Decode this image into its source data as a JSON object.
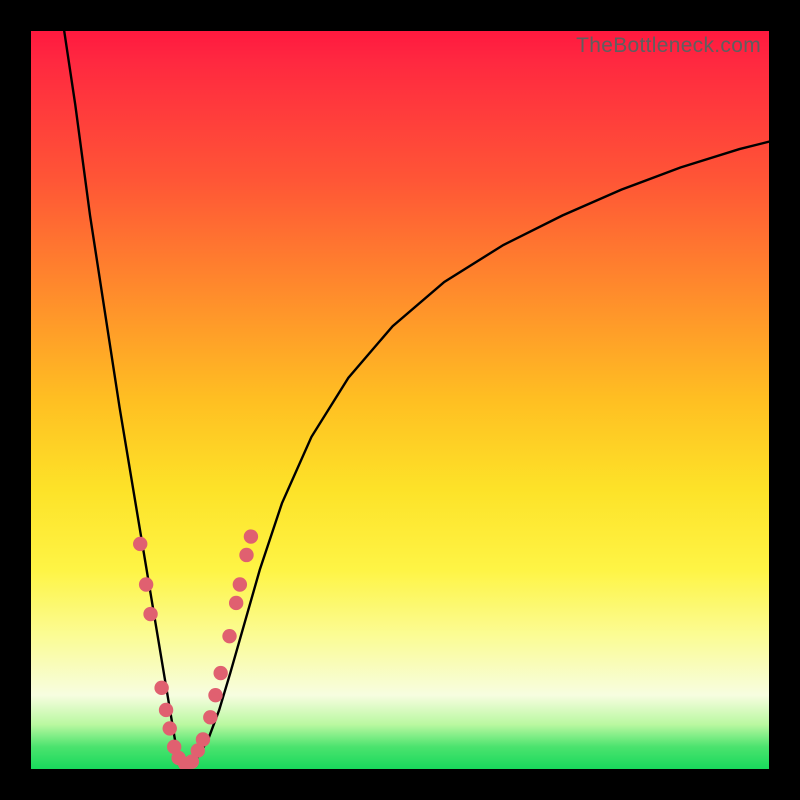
{
  "watermark": "TheBottleneck.com",
  "colors": {
    "frame": "#000000",
    "curve_stroke": "#000000",
    "marker_fill": "#e06070",
    "marker_stroke": "#b24a58"
  },
  "chart_data": {
    "type": "line",
    "title": "",
    "xlabel": "",
    "ylabel": "",
    "xlim": [
      0,
      100
    ],
    "ylim": [
      0,
      100
    ],
    "note": "Axes are implicit (no ticks/labels). Values are percentage positions. x = horizontal from left, y = vertical from bottom. Curve is V-shaped with minimum near x≈20, rising steeply on both sides; right branch asymptotes toward y≈85. Background gradient encodes y (red high, green low).",
    "series": [
      {
        "name": "bottleneck-curve",
        "x": [
          4.5,
          6,
          8,
          10,
          12,
          14,
          15.5,
          17,
          18.5,
          19.5,
          20.5,
          21.5,
          22.5,
          24,
          25.5,
          27,
          29,
          31,
          34,
          38,
          43,
          49,
          56,
          64,
          72,
          80,
          88,
          96,
          100
        ],
        "y": [
          100,
          90,
          75,
          62,
          49,
          37,
          28,
          19,
          10,
          4,
          1,
          0.6,
          1.5,
          4,
          8,
          13,
          20,
          27,
          36,
          45,
          53,
          60,
          66,
          71,
          75,
          78.5,
          81.5,
          84,
          85
        ]
      }
    ],
    "markers": {
      "name": "highlighted-points",
      "note": "Pink dot markers clustered near the bottom of the V on both branches.",
      "points": [
        {
          "x": 14.8,
          "y": 30.5
        },
        {
          "x": 15.6,
          "y": 25.0
        },
        {
          "x": 16.2,
          "y": 21.0
        },
        {
          "x": 17.7,
          "y": 11.0
        },
        {
          "x": 18.3,
          "y": 8.0
        },
        {
          "x": 18.8,
          "y": 5.5
        },
        {
          "x": 19.4,
          "y": 3.0
        },
        {
          "x": 20.0,
          "y": 1.5
        },
        {
          "x": 20.9,
          "y": 0.7
        },
        {
          "x": 21.8,
          "y": 1.0
        },
        {
          "x": 22.6,
          "y": 2.5
        },
        {
          "x": 23.3,
          "y": 4.0
        },
        {
          "x": 24.3,
          "y": 7.0
        },
        {
          "x": 25.0,
          "y": 10.0
        },
        {
          "x": 25.7,
          "y": 13.0
        },
        {
          "x": 26.9,
          "y": 18.0
        },
        {
          "x": 27.8,
          "y": 22.5
        },
        {
          "x": 28.3,
          "y": 25.0
        },
        {
          "x": 29.2,
          "y": 29.0
        },
        {
          "x": 29.8,
          "y": 31.5
        }
      ]
    }
  }
}
